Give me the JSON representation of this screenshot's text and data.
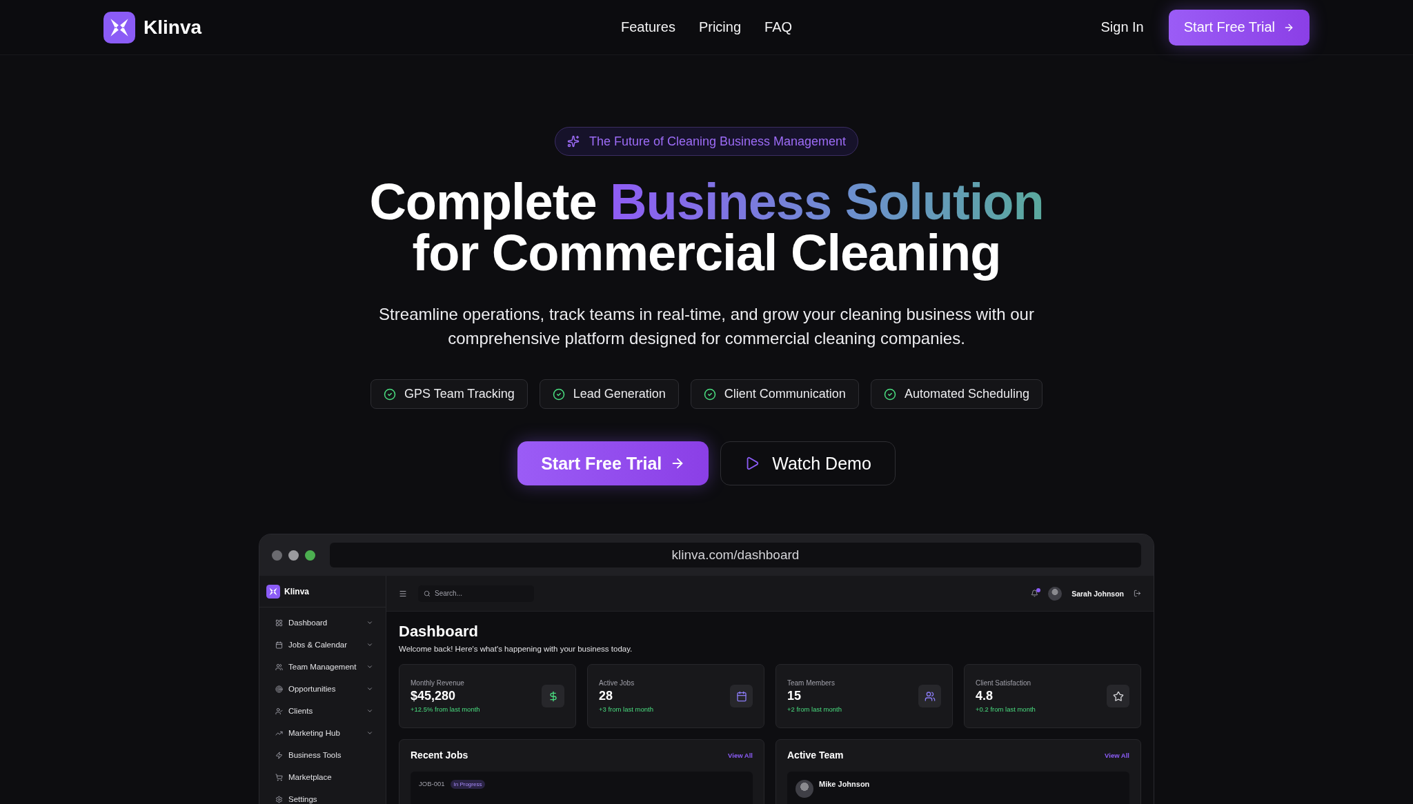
{
  "header": {
    "brand": "Klinva",
    "nav": [
      "Features",
      "Pricing",
      "FAQ"
    ],
    "sign_in": "Sign In",
    "cta": "Start Free Trial"
  },
  "hero": {
    "badge": "The Future of Cleaning Business Management",
    "title": [
      [
        {
          "text": "Complete ",
          "highlight": false
        },
        {
          "text": "Business Solution",
          "highlight": true
        }
      ],
      [
        {
          "text": "for Commercial Cleaning",
          "highlight": false
        }
      ]
    ],
    "subtitle": "Streamline operations, track teams in real-time, and grow your cleaning business with our comprehensive platform designed for commercial cleaning companies.",
    "features": [
      "GPS Team Tracking",
      "Lead Generation",
      "Client Communication",
      "Automated Scheduling"
    ],
    "primary_button": "Start Free Trial",
    "secondary_button": "Watch Demo"
  },
  "preview": {
    "url": "klinva.com/dashboard",
    "brand": "Klinva",
    "search_placeholder": "Search...",
    "user": "Sarah Johnson",
    "has_notification": true,
    "sidebar": [
      {
        "label": "Dashboard",
        "kind": "grid",
        "expandable": true
      },
      {
        "label": "Jobs & Calendar",
        "kind": "calendar",
        "expandable": true
      },
      {
        "label": "Team Management",
        "kind": "users",
        "expandable": true
      },
      {
        "label": "Opportunities",
        "kind": "target",
        "expandable": true
      },
      {
        "label": "Clients",
        "kind": "client",
        "expandable": true
      },
      {
        "label": "Marketing Hub",
        "kind": "trend",
        "expandable": true
      },
      {
        "label": "Business Tools",
        "kind": "zap",
        "expandable": false
      },
      {
        "label": "Marketplace",
        "kind": "cart",
        "expandable": false
      },
      {
        "label": "Settings",
        "kind": "gear",
        "expandable": false
      }
    ],
    "title": "Dashboard",
    "welcome": "Welcome back! Here's what's happening with your business today.",
    "stats": [
      {
        "label": "Monthly Revenue",
        "value": "$45,280",
        "change": "+12.5% from last month",
        "kind": "dollar",
        "color": "#4ade80"
      },
      {
        "label": "Active Jobs",
        "value": "28",
        "change": "+3 from last month",
        "kind": "calendar",
        "color": "#8b7cf6"
      },
      {
        "label": "Team Members",
        "value": "15",
        "change": "+2 from last month",
        "kind": "users",
        "color": "#8b7cf6"
      },
      {
        "label": "Client Satisfaction",
        "value": "4.8",
        "change": "+0.2 from last month",
        "kind": "star",
        "color": "#d4d4d8"
      }
    ],
    "recent_jobs": {
      "title": "Recent Jobs",
      "link": "View All",
      "rows": [
        {
          "id": "JOB-001",
          "status": "In Progress"
        }
      ]
    },
    "active_team": {
      "title": "Active Team",
      "link": "View All",
      "rows": [
        {
          "name": "Mike Johnson"
        }
      ]
    }
  }
}
